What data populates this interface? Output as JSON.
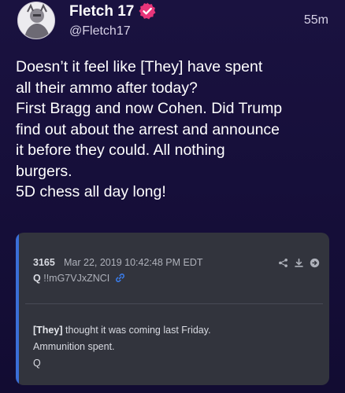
{
  "post": {
    "display_name": "Fletch 17",
    "handle": "@Fletch17",
    "time_ago": "55m",
    "verified": true,
    "body_lines": [
      "Doesn’t it feel like [They] have spent",
      "all their ammo after today?",
      "First Bragg and now Cohen. Did Trump",
      "find out about the arrest and announce",
      "it before they could. All nothing",
      "burgers.",
      "5D chess all day long!"
    ]
  },
  "quote": {
    "post_number": "3165",
    "date": "Mar 22, 2019 10:42:48 PM EDT",
    "author": "Q",
    "tripcode": "!!mG7VJxZNCI",
    "text_tag": "[They]",
    "text_line1_rest": " thought it was coming last Friday.",
    "text_line2": "Ammunition spent.",
    "text_line3": "Q",
    "accent_color": "#3a6fd8"
  },
  "colors": {
    "background": "#17103a",
    "card": "#32343d",
    "verified_badge": "#e8357a"
  },
  "icons": [
    "avatar-image",
    "verified-badge-icon",
    "link-icon",
    "share-icon",
    "download-icon",
    "open-arrow-icon"
  ]
}
